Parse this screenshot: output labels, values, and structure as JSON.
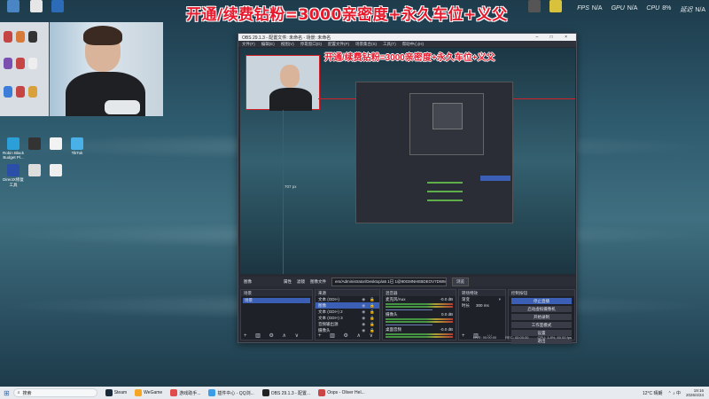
{
  "banner": "开通/续费钻粉=3000亲密度+永久车位+义父",
  "stats": [
    {
      "label": "FPS",
      "value": "N/A"
    },
    {
      "label": "GPU",
      "value": "N/A"
    },
    {
      "label": "CPU",
      "value": "8%"
    },
    {
      "label": "延迟",
      "value": "N/A"
    }
  ],
  "desktop_icons": [
    "Robin Black Budget Pl...",
    "DirectX修复工具",
    "TikTok",
    "Steam"
  ],
  "obs": {
    "title": "OBS 29.1.3 - 配置文件: 未命名 - 场景: 未命名",
    "menu": [
      "文件(F)",
      "编辑(E)",
      "视图(V)",
      "停靠窗口(D)",
      "配置文件(P)",
      "场景集合(S)",
      "工具(T)",
      "帮助中心(H)"
    ],
    "preview_banner": "开通/续费钻粉=3000亲密度+永久车位+义父",
    "px_label": "707 px",
    "toolbar": {
      "image_label": "图像",
      "props": "属性",
      "filters": "滤镜",
      "image_file_label": "图像文件",
      "path": "ers/Administrator/Desktop/a5 1已 1@90GMNHEBDEOV7DWM.png",
      "browse": "浏览"
    },
    "docks": {
      "scenes": {
        "title": "场景",
        "items": [
          "场景"
        ]
      },
      "sources": {
        "title": "来源",
        "items": [
          "文本 (GDI+)",
          "图像",
          "文本 (GDI+) 2",
          "文本 (GDI+) 3",
          "音频输出源",
          "摄像头",
          "图像"
        ]
      },
      "mixer": {
        "title": "混音器",
        "channels": [
          {
            "name": "麦克风/Aux",
            "db": "-0.0 dB"
          },
          {
            "name": "摄像头",
            "db": "0.0 dB"
          },
          {
            "name": "桌面音频",
            "db": "-0.0 dB"
          }
        ]
      },
      "transitions": {
        "title": "转场特效",
        "type": "渐变",
        "duration_label": "时长",
        "duration": "300 ms"
      },
      "controls": {
        "title": "控制按钮",
        "buttons": [
          "停止直播",
          "启动虚拟摄像机",
          "开始录制",
          "工作室模式",
          "设置",
          "退出"
        ]
      }
    },
    "status": {
      "live": "LIVE: 00:00:00",
      "rec": "REC: 00:00:00",
      "cpu": "CPU: 1.8%, 60.00 fps"
    }
  },
  "taskbar": {
    "search": "搜索",
    "tasks": [
      "Steam",
      "WeGame",
      "游戏助手...",
      "插件中心 - QQ浏...",
      "OBS 29.1.3 - 配置...",
      "Oops - Oliver Hel..."
    ],
    "weather": "12°C 晴朗",
    "time": "19:16",
    "date": "2026/4/24"
  }
}
